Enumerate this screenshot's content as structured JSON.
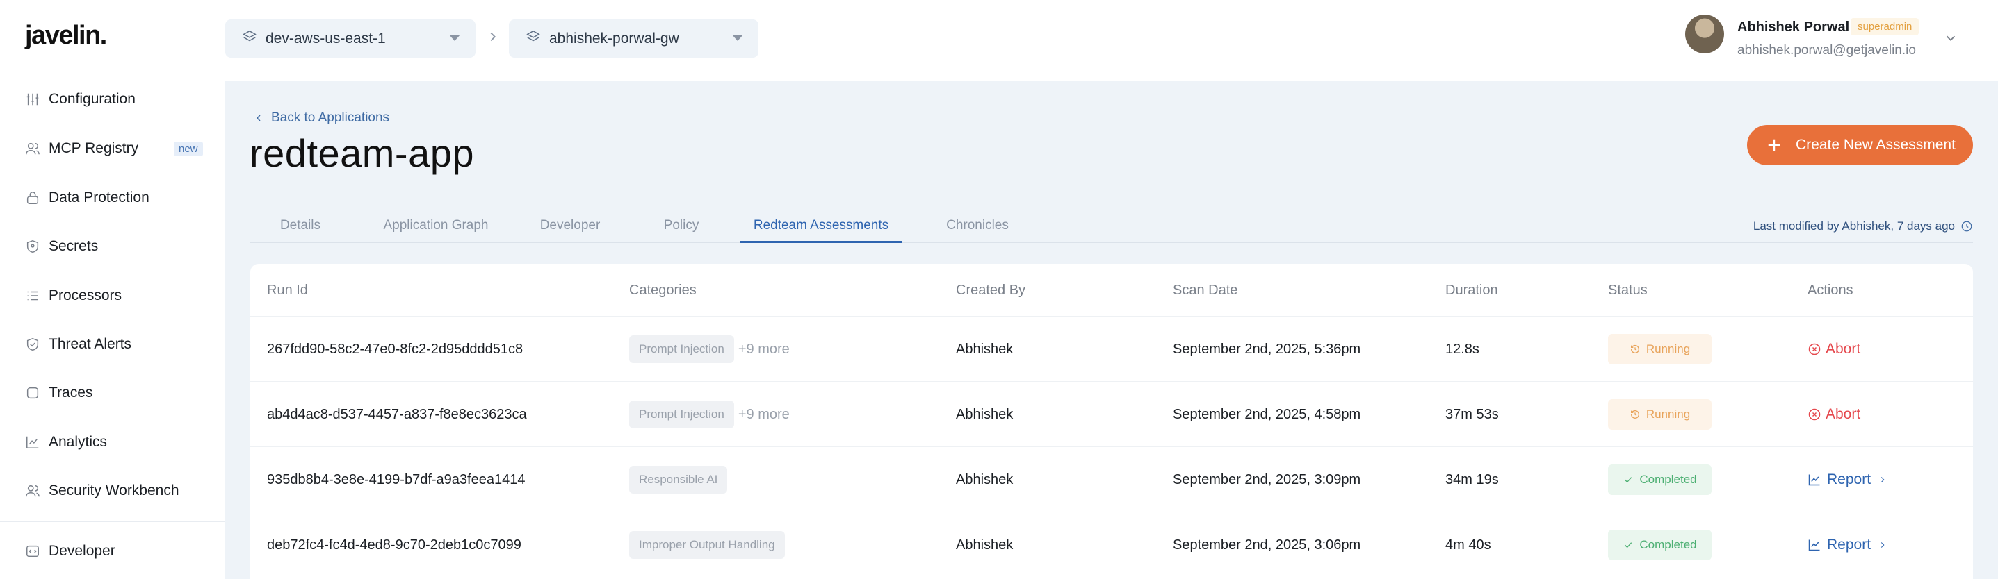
{
  "app": {
    "logo": "javelin."
  },
  "sidebar": {
    "items": [
      {
        "label": "Configuration",
        "icon": "sliders-icon"
      },
      {
        "label": "MCP Registry",
        "icon": "users-icon",
        "badge": "new"
      },
      {
        "label": "Data Protection",
        "icon": "lock-icon"
      },
      {
        "label": "Secrets",
        "icon": "shield-icon"
      },
      {
        "label": "Processors",
        "icon": "list-icon"
      },
      {
        "label": "Threat Alerts",
        "icon": "shield-check-icon"
      },
      {
        "label": "Traces",
        "icon": "square-icon"
      },
      {
        "label": "Analytics",
        "icon": "chart-icon"
      },
      {
        "label": "Security Workbench",
        "icon": "users-icon"
      },
      {
        "label": "Developer",
        "icon": "code-icon"
      }
    ]
  },
  "topbar": {
    "environment": "dev-aws-us-east-1",
    "gateway": "abhishek-porwal-gw"
  },
  "user": {
    "name": "Abhishek Porwal",
    "role": "superadmin",
    "email": "abhishek.porwal@getjavelin.io"
  },
  "page": {
    "back_label": "Back to Applications",
    "title": "redteam-app",
    "create_button": "Create New Assessment",
    "last_modified": "Last modified by Abhishek, 7 days ago"
  },
  "tabs": [
    "Details",
    "Application Graph",
    "Developer",
    "Policy",
    "Redteam Assessments",
    "Chronicles"
  ],
  "active_tab": "Redteam Assessments",
  "table": {
    "headers": [
      "Run Id",
      "Categories",
      "Created By",
      "Scan Date",
      "Duration",
      "Status",
      "Actions"
    ],
    "rows": [
      {
        "run_id": "267fdd90-58c2-47e0-8fc2-2d95dddd51c8",
        "category": "Prompt Injection",
        "more": "+9 more",
        "created_by": "Abhishek",
        "scan_date": "September 2nd, 2025, 5:36pm",
        "duration": "12.8s",
        "status": "Running",
        "action": "Abort"
      },
      {
        "run_id": "ab4d4ac8-d537-4457-a837-f8e8ec3623ca",
        "category": "Prompt Injection",
        "more": "+9 more",
        "created_by": "Abhishek",
        "scan_date": "September 2nd, 2025, 4:58pm",
        "duration": "37m 53s",
        "status": "Running",
        "action": "Abort"
      },
      {
        "run_id": "935db8b4-3e8e-4199-b7df-a9a3feea1414",
        "category": "Responsible AI",
        "more": "",
        "created_by": "Abhishek",
        "scan_date": "September 2nd, 2025, 3:09pm",
        "duration": "34m 19s",
        "status": "Completed",
        "action": "Report"
      },
      {
        "run_id": "deb72fc4-fc4d-4ed8-9c70-2deb1c0c7099",
        "category": "Improper Output Handling",
        "more": "",
        "created_by": "Abhishek",
        "scan_date": "September 2nd, 2025, 3:06pm",
        "duration": "4m 40s",
        "status": "Completed",
        "action": "Report"
      }
    ]
  },
  "colors": {
    "accent": "#e8703a",
    "link": "#2e64b0",
    "running": "#e8a35a",
    "completed": "#4caf72",
    "abort": "#e5484d",
    "main_bg": "#eef3f8"
  }
}
